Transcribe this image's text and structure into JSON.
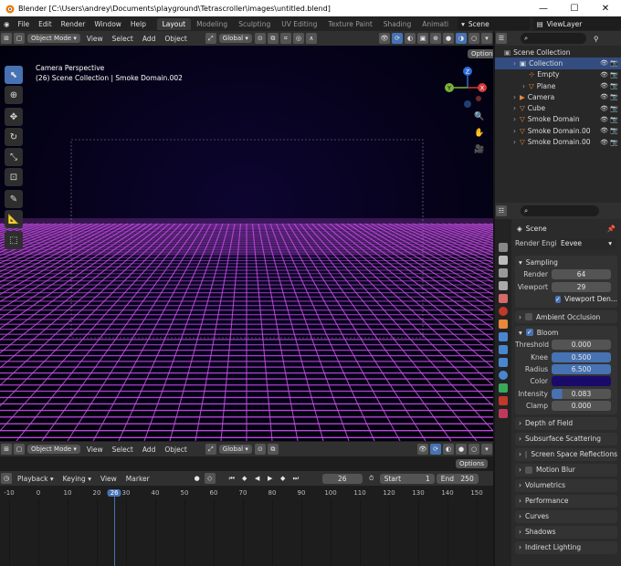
{
  "window": {
    "title": "Blender [C:\\Users\\andrey\\Documents\\playground\\Tetrascroller\\images\\untitled.blend]",
    "minimize": "—",
    "maximize": "☐",
    "close": "✕"
  },
  "menu": [
    "File",
    "Edit",
    "Render",
    "Window",
    "Help"
  ],
  "workspaces": [
    "Layout",
    "Modeling",
    "Sculpting",
    "UV Editing",
    "Texture Paint",
    "Shading",
    "Animati"
  ],
  "scene": "Scene",
  "view_layer": "ViewLayer",
  "viewport_header": {
    "mode": "Object Mode",
    "menus": [
      "View",
      "Select",
      "Add",
      "Object"
    ],
    "orientation": "Global",
    "options": "Options"
  },
  "viewport": {
    "line1": "Camera Perspective",
    "line2": "(26) Scene Collection | Smoke Domain.002",
    "gizmo": {
      "x": "X",
      "y": "Y",
      "z": "Z"
    }
  },
  "colors": {
    "grid": "#c94ee8",
    "background": "#00000a",
    "accent": "#4772b3",
    "bloom_color": "#1a0a6a"
  },
  "outliner": {
    "root": "Scene Collection",
    "items": [
      {
        "label": "Collection",
        "indent": 1,
        "icon": "collection-icon"
      },
      {
        "label": "Empty",
        "indent": 2,
        "icon": "empty-icon"
      },
      {
        "label": "Plane",
        "indent": 2,
        "icon": "mesh-icon"
      },
      {
        "label": "Camera",
        "indent": 1,
        "icon": "camera-icon"
      },
      {
        "label": "Cube",
        "indent": 1,
        "icon": "mesh-icon"
      },
      {
        "label": "Smoke Domain",
        "indent": 1,
        "icon": "mesh-icon"
      },
      {
        "label": "Smoke Domain.00",
        "indent": 1,
        "icon": "mesh-icon"
      },
      {
        "label": "Smoke Domain.00",
        "indent": 1,
        "icon": "mesh-icon"
      }
    ]
  },
  "properties": {
    "scene_label": "Scene",
    "render_engine_label": "Render Engin",
    "render_engine": "Eevee",
    "sampling": {
      "title": "Sampling",
      "render_label": "Render",
      "render": "64",
      "viewport_label": "Viewport",
      "viewport": "29",
      "denoise": "Viewport Den..."
    },
    "ambient_occlusion": "Ambient Occlusion",
    "bloom": {
      "title": "Bloom",
      "threshold_label": "Threshold",
      "threshold": "0.000",
      "knee_label": "Knee",
      "knee": "0.500",
      "radius_label": "Radius",
      "radius": "6.500",
      "color_label": "Color",
      "intensity_label": "Intensity",
      "intensity": "0.083",
      "clamp_label": "Clamp",
      "clamp": "0.000"
    },
    "collapsed": [
      "Depth of Field",
      "Subsurface Scattering",
      "Screen Space Reflections",
      "Motion Blur",
      "Volumetrics",
      "Performance",
      "Curves",
      "Shadows",
      "Indirect Lighting"
    ]
  },
  "timeline": {
    "menus": [
      "Playback",
      "Keying",
      "View",
      "Marker"
    ],
    "current_frame": "26",
    "start_label": "Start",
    "start": "1",
    "end_label": "End",
    "end": "250",
    "ticks": [
      "-10",
      "0",
      "10",
      "20",
      "26",
      "30",
      "40",
      "50",
      "60",
      "70",
      "80",
      "90",
      "100",
      "110",
      "120",
      "130",
      "140",
      "150"
    ]
  }
}
